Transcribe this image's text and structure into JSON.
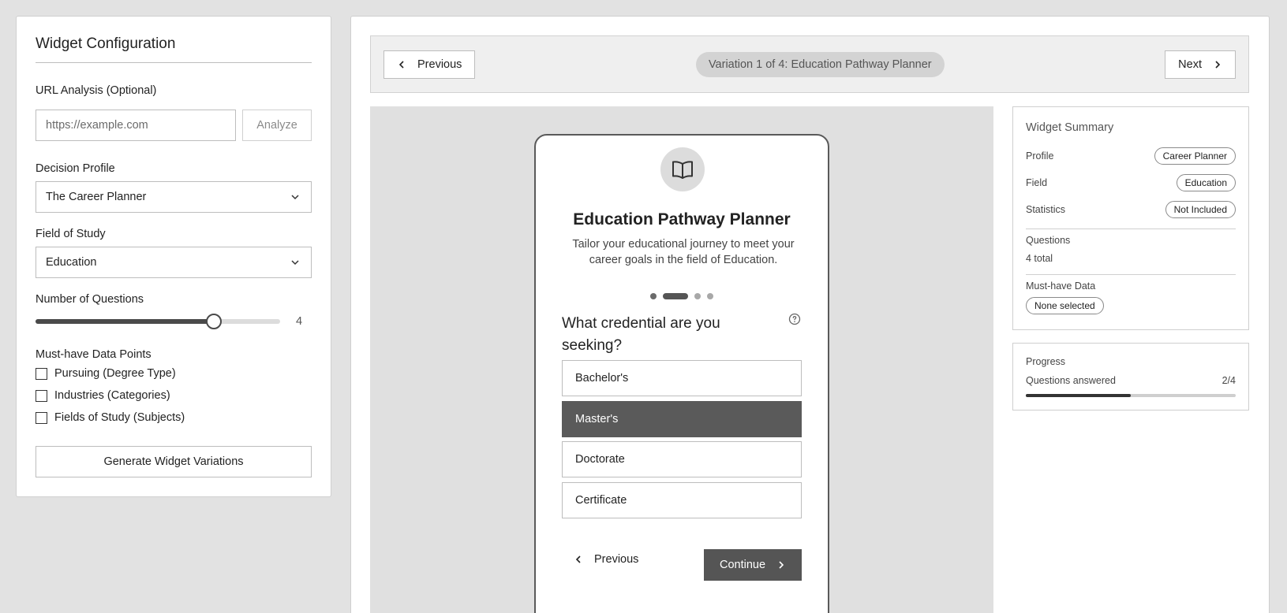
{
  "config": {
    "title": "Widget Configuration",
    "url_label": "URL Analysis (Optional)",
    "url_placeholder": "https://example.com",
    "analyze_label": "Analyze",
    "decision_profile_label": "Decision Profile",
    "decision_profile_value": "The Career Planner",
    "field_label": "Field of Study",
    "field_value": "Education",
    "num_questions_label": "Number of Questions",
    "num_questions_value": "4",
    "num_questions_slider_fraction": 0.73,
    "must_have_label": "Must-have Data Points",
    "must_have_options": [
      {
        "label": "Pursuing (Degree Type)",
        "checked": false
      },
      {
        "label": "Industries (Categories)",
        "checked": false
      },
      {
        "label": "Fields of Study (Subjects)",
        "checked": false
      }
    ],
    "generate_label": "Generate Widget Variations"
  },
  "nav": {
    "previous_label": "Previous",
    "variation_label": "Variation 1 of 4: Education Pathway Planner",
    "next_label": "Next"
  },
  "widget": {
    "icon": "book-open-icon",
    "title": "Education Pathway Planner",
    "description": "Tailor your educational journey to meet your career goals in the field of Education.",
    "current_step": 2,
    "total_steps": 4,
    "question": "What credential are you seeking?",
    "options": [
      {
        "label": "Bachelor's",
        "selected": false
      },
      {
        "label": "Master's",
        "selected": true
      },
      {
        "label": "Doctorate",
        "selected": false
      },
      {
        "label": "Certificate",
        "selected": false
      }
    ],
    "previous_label": "Previous",
    "continue_label": "Continue"
  },
  "summary": {
    "title": "Widget Summary",
    "profile_label": "Profile",
    "profile_value": "Career Planner",
    "field_label": "Field",
    "field_value": "Education",
    "statistics_label": "Statistics",
    "statistics_value": "Not Included",
    "questions_label": "Questions",
    "questions_value": "4 total",
    "must_have_label": "Must-have Data",
    "must_have_value": "None selected"
  },
  "progress": {
    "title": "Progress",
    "label": "Questions answered",
    "value_text": "2/4",
    "fraction": 0.5
  },
  "colors": {
    "background": "#e2e2e2",
    "selected_option": "#5a5a5a",
    "continue_button": "#555555"
  }
}
